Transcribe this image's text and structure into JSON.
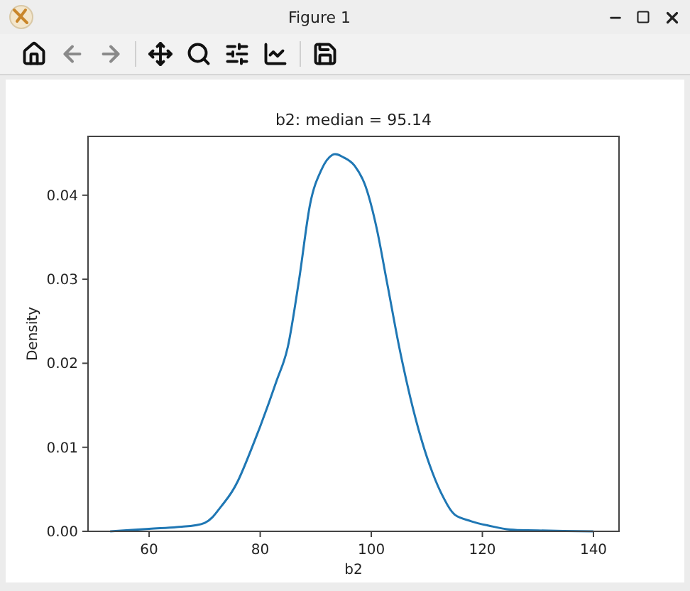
{
  "window": {
    "title": "Figure 1"
  },
  "toolbar": [
    {
      "kind": "home",
      "disabled": false
    },
    {
      "kind": "back",
      "disabled": true
    },
    {
      "kind": "forward",
      "disabled": true
    },
    {
      "kind": "pan",
      "disabled": false
    },
    {
      "kind": "zoom",
      "disabled": false
    },
    {
      "kind": "subplots",
      "disabled": false
    },
    {
      "kind": "customize",
      "disabled": false
    },
    {
      "kind": "save",
      "disabled": false
    }
  ],
  "figure": {
    "chart_data": {
      "type": "line",
      "title": "b2: median = 95.14",
      "xlabel": "b2",
      "ylabel": "Density",
      "xlim": [
        49,
        144.6
      ],
      "ylim": [
        0,
        0.047
      ],
      "xticks": [
        60,
        80,
        100,
        120,
        140
      ],
      "yticks": [
        {
          "value": 0,
          "label": "0.00"
        },
        {
          "value": 0.01,
          "label": "0.01"
        },
        {
          "value": 0.02,
          "label": "0.02"
        },
        {
          "value": 0.03,
          "label": "0.03"
        },
        {
          "value": 0.04,
          "label": "0.04"
        }
      ],
      "x": [
        53,
        60,
        65,
        70,
        73,
        76,
        80,
        83,
        85,
        87,
        89,
        91,
        93,
        95,
        97,
        99,
        101,
        103,
        105,
        107,
        109,
        111,
        113,
        115,
        118,
        121,
        125,
        130,
        140
      ],
      "series": [
        {
          "color": "#1f77b4",
          "values": [
            0,
            0.0003,
            0.0005,
            0.001,
            0.003,
            0.006,
            0.0125,
            0.018,
            0.022,
            0.03,
            0.039,
            0.043,
            0.0448,
            0.0445,
            0.0435,
            0.041,
            0.036,
            0.029,
            0.022,
            0.016,
            0.011,
            0.007,
            0.004,
            0.002,
            0.0012,
            0.0007,
            0.0002,
            0.0001,
            0
          ]
        }
      ]
    }
  }
}
